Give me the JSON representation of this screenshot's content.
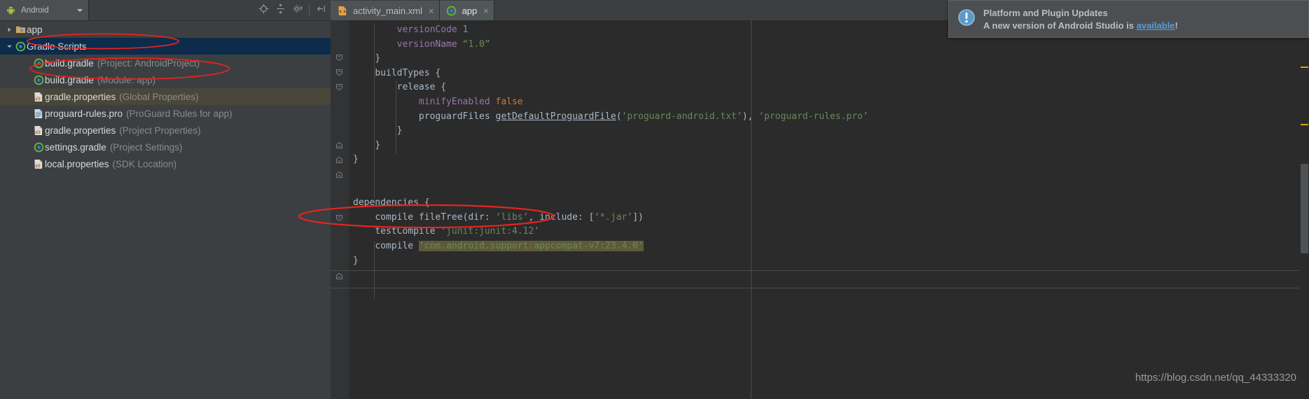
{
  "panel": {
    "selector": {
      "label": "Android",
      "icon": "android-robot-icon"
    },
    "icons": [
      {
        "name": "locate-target-icon"
      },
      {
        "name": "collapse-all-icon"
      },
      {
        "name": "settings-gear-icon"
      },
      {
        "name": "hide-panel-icon"
      }
    ],
    "tree": [
      {
        "name": "app",
        "meta": "",
        "icon": "folder-module-icon",
        "arrow": "collapsed",
        "indent": 1,
        "state": "normal"
      },
      {
        "name": "Gradle Scripts",
        "meta": "",
        "icon": "gradle-icon",
        "arrow": "expanded",
        "indent": 1,
        "state": "selected"
      },
      {
        "name": "build.gradle",
        "meta": "(Project: AndroidProject)",
        "icon": "gradle-icon",
        "arrow": "none",
        "indent": 2,
        "state": "normal"
      },
      {
        "name": "build.gradle",
        "meta": "(Module: app)",
        "icon": "gradle-icon",
        "arrow": "none",
        "indent": 2,
        "state": "normal"
      },
      {
        "name": "gradle.properties",
        "meta": "(Global Properties)",
        "icon": "properties-icon",
        "arrow": "none",
        "indent": 2,
        "state": "hover"
      },
      {
        "name": "proguard-rules.pro",
        "meta": "(ProGuard Rules for app)",
        "icon": "text-file-icon",
        "arrow": "none",
        "indent": 2,
        "state": "normal"
      },
      {
        "name": "gradle.properties",
        "meta": "(Project Properties)",
        "icon": "properties-icon",
        "arrow": "none",
        "indent": 2,
        "state": "normal"
      },
      {
        "name": "settings.gradle",
        "meta": "(Project Settings)",
        "icon": "gradle-icon",
        "arrow": "none",
        "indent": 2,
        "state": "normal"
      },
      {
        "name": "local.properties",
        "meta": "(SDK Location)",
        "icon": "properties-icon",
        "arrow": "none",
        "indent": 2,
        "state": "normal"
      }
    ]
  },
  "editor": {
    "tabs": [
      {
        "label": "activity_main.xml",
        "icon": "xml-layout-icon",
        "close": "×",
        "active": false
      },
      {
        "label": "app",
        "icon": "gradle-icon",
        "close": "×",
        "active": true
      }
    ],
    "lines": [
      {
        "indent": 8,
        "tokens": [
          {
            "t": "versionCode ",
            "c": "kw"
          },
          {
            "t": "1",
            "c": "num"
          }
        ]
      },
      {
        "indent": 8,
        "tokens": [
          {
            "t": "versionName ",
            "c": "kw"
          },
          {
            "t": "“1.0”",
            "c": "str"
          }
        ]
      },
      {
        "indent": 4,
        "tokens": [
          {
            "t": "}",
            "c": "pl"
          }
        ]
      },
      {
        "indent": 4,
        "tokens": [
          {
            "t": "buildTypes {",
            "c": "pl"
          }
        ]
      },
      {
        "indent": 8,
        "tokens": [
          {
            "t": "release {",
            "c": "pl"
          }
        ]
      },
      {
        "indent": 12,
        "tokens": [
          {
            "t": "minifyEnabled ",
            "c": "kw"
          },
          {
            "t": "false",
            "c": "bl"
          }
        ]
      },
      {
        "indent": 12,
        "tokens": [
          {
            "t": "proguardFiles ",
            "c": "pl"
          },
          {
            "t": "getDefaultProguardFile",
            "c": "fn"
          },
          {
            "t": "(",
            "c": "pl"
          },
          {
            "t": "‘proguard-android.txt’",
            "c": "str"
          },
          {
            "t": "), ",
            "c": "pl"
          },
          {
            "t": "‘proguard-rules.pro’",
            "c": "str"
          }
        ]
      },
      {
        "indent": 8,
        "tokens": [
          {
            "t": "}",
            "c": "pl"
          }
        ]
      },
      {
        "indent": 4,
        "tokens": [
          {
            "t": "}",
            "c": "pl"
          }
        ]
      },
      {
        "indent": 0,
        "tokens": [
          {
            "t": "}",
            "c": "pl"
          }
        ]
      },
      {
        "indent": 0,
        "tokens": [
          {
            "t": "",
            "c": "pl"
          }
        ]
      },
      {
        "indent": 0,
        "tokens": [
          {
            "t": "",
            "c": "pl"
          }
        ]
      },
      {
        "indent": 0,
        "tokens": [
          {
            "t": "dependencies {",
            "c": "pl"
          }
        ]
      },
      {
        "indent": 4,
        "tokens": [
          {
            "t": "compile fileTree(",
            "c": "pl"
          },
          {
            "t": "dir: ",
            "c": "pl"
          },
          {
            "t": "‘libs’",
            "c": "str"
          },
          {
            "t": ", include: [",
            "c": "pl"
          },
          {
            "t": "‘*.jar’",
            "c": "str"
          },
          {
            "t": "])",
            "c": "pl"
          }
        ]
      },
      {
        "indent": 4,
        "tokens": [
          {
            "t": "testCompile ",
            "c": "pl"
          },
          {
            "t": "‘junit:junit:4.12’",
            "c": "str"
          }
        ]
      },
      {
        "indent": 4,
        "tokens": [
          {
            "t": "compile ",
            "c": "pl"
          },
          {
            "t": "‘com.android.support:appcompat-v7:23.4.0’",
            "c": "str hl"
          }
        ]
      },
      {
        "indent": 0,
        "tokens": [
          {
            "t": "}",
            "c": "pl"
          }
        ]
      }
    ]
  },
  "notification": {
    "icon": "info-exclamation-icon",
    "title": "Platform and Plugin Updates",
    "message_prefix": "A new version of Android Studio is ",
    "link": "available",
    "message_suffix": "!"
  },
  "watermark": {
    "text": "https://blog.csdn.net/qq_44333320"
  },
  "colors": {
    "selection": "#0d2c4b",
    "hover": "#4a4639",
    "annotation": "#e8241f",
    "link": "#5a9bd5",
    "warning_mark": "#d4a017",
    "string": "#6a8759",
    "keyword": "#9876aa",
    "number": "#6897bb"
  }
}
